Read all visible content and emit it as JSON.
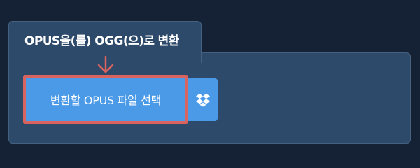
{
  "converter": {
    "tab_title": "OPUS을(를) OGG(으)로 변환",
    "select_button_label": "변환할 OPUS 파일 선택",
    "dropbox_button_icon": "dropbox-icon",
    "arrow_icon": "arrow-down-icon"
  },
  "colors": {
    "background": "#152236",
    "panel": "#2e4a6b",
    "button": "#4b9ae8",
    "highlight": "#d9635e"
  }
}
